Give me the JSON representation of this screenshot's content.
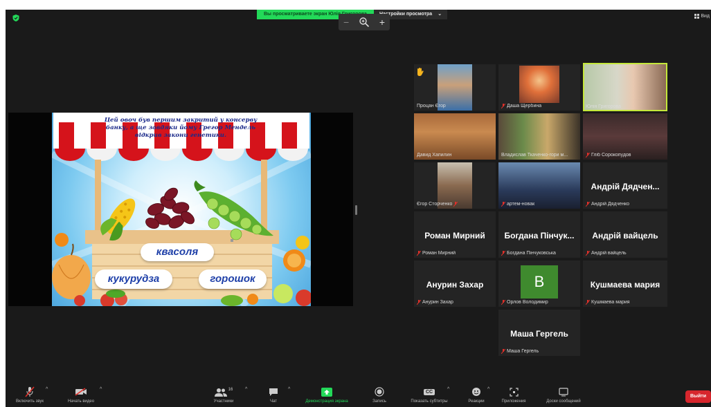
{
  "share_banner": {
    "message": "Вы просматриваете экран Юлія Григорова",
    "view_options": "Настройки просмотра",
    "view_options_caret": "⌄"
  },
  "zoom_control": {
    "minus": "−",
    "plus": "+"
  },
  "view_button": {
    "label": "Вид"
  },
  "slide": {
    "question": "Цей овоч був першим закритий у консерву банку, а ще завдяки йому Грегор Мендель відкрив закони генетики.",
    "options": [
      "квасоля",
      "кукурудза",
      "горошок"
    ]
  },
  "participants": [
    {
      "name": "Процан Єгор",
      "muted": false,
      "hand": true,
      "video": true
    },
    {
      "name": "Даша Щербина",
      "muted": true,
      "video": true
    },
    {
      "name": "Юлія Григорова",
      "muted": false,
      "video": true,
      "active": true
    },
    {
      "name": "Давид Хапилин",
      "muted": false,
      "video": true
    },
    {
      "name": "Владислав Ткаченко-гори м...",
      "muted": false,
      "video": true
    },
    {
      "name": "Гліб Сорокопудов",
      "muted": true,
      "video": true
    },
    {
      "name": "Єгор Сторченко",
      "muted": true,
      "video": true
    },
    {
      "name": "артем-новак",
      "muted": true,
      "video": true
    },
    {
      "name": "Андрій Дядченко",
      "display": "Андрій Дядчен...",
      "muted": true,
      "video": false
    },
    {
      "name": "Роман Мирний",
      "display": "Роман Мирний",
      "muted": true,
      "video": false
    },
    {
      "name": "Богдана Пінчуковська",
      "display": "Богдана Пінчук...",
      "muted": true,
      "video": false
    },
    {
      "name": "Андрій вайцель",
      "display": "Андрій вайцель",
      "muted": true,
      "video": false
    },
    {
      "name": "Анурин Захар",
      "display": "Анурин Захар",
      "muted": true,
      "video": false
    },
    {
      "name": "Орлов Володимир",
      "avatar_letter": "B",
      "muted": true,
      "video": false
    },
    {
      "name": "Кушмаева мария",
      "display": "Кушмаева мария",
      "muted": true,
      "video": false
    },
    {
      "name": "Маша Гергель",
      "display": "Маша Гергель",
      "muted": true,
      "video": false
    }
  ],
  "toolbar": {
    "mic": "Включить звук",
    "video": "Начать видео",
    "participants": "Участники",
    "participants_count": "16",
    "chat": "Чат",
    "share": "Демонстрация экрана",
    "record": "Запись",
    "captions": "Показать субтитры",
    "captions_icon": "CC",
    "reactions": "Реакции",
    "apps": "Приложения",
    "whiteboards": "Доски сообщений",
    "caret": "^",
    "exit": "Выйти"
  },
  "colors": {
    "share_green": "#23d959",
    "active_speaker": "#c4e83a",
    "muted_red": "#e0302a",
    "exit_red": "#d7262d",
    "avatar_green": "#3f8a2e"
  }
}
